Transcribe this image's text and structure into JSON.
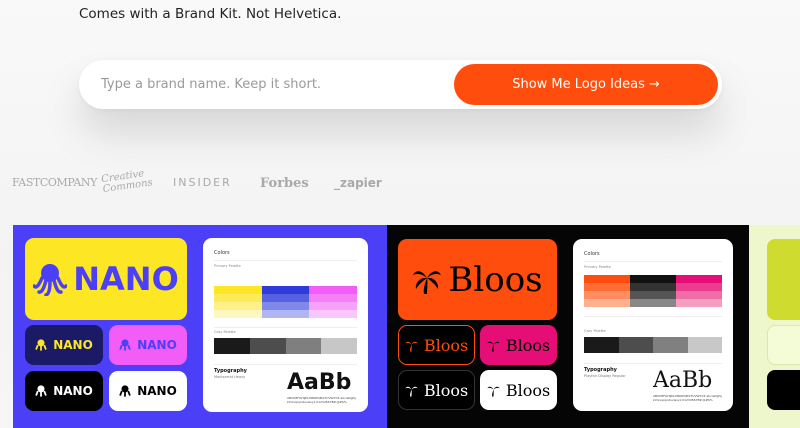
{
  "tagline": "Comes with a Brand Kit. Not Helvetica.",
  "search": {
    "placeholder": "Type a brand name. Keep it short.",
    "button_label": "Show Me Logo Ideas",
    "button_arrow": "→"
  },
  "press_logos": [
    "FASTCOMPANY",
    "Creative Commons",
    "INSIDER",
    "Forbes",
    "_zapier"
  ],
  "brand_nano": {
    "name": "NANO",
    "colors": {
      "panel": "#4b3ff7",
      "yellow": "#fde725",
      "navy": "#1b1a66",
      "pink": "#f15df6",
      "black": "#000000",
      "white": "#ffffff"
    },
    "card": {
      "colors_heading": "Colors",
      "primary_label": "Primary Palette",
      "gray_label": "Gray Palette",
      "typography_label": "Typography",
      "typography_sub": "Montserrat Heavy",
      "specimen": "AaBb",
      "glyphs": "ABCDEFGHIJKLMNOPQRSTUVWXYZ abcdefghijklmnopqrstuvwxyz 0123456789!@#$%"
    }
  },
  "brand_bloos": {
    "name": "Bloos",
    "colors": {
      "orange": "#ff4d0d",
      "magenta": "#e60d77",
      "black": "#000000",
      "white": "#ffffff"
    },
    "card": {
      "colors_heading": "Colors",
      "primary_label": "Primary Palette",
      "gray_label": "Gray Palette",
      "typography_label": "Typography",
      "typography_sub": "Playfair Display Regular",
      "specimen": "AaBb",
      "glyphs": "ABCDEFGHIJKLMNOPQRSTUVWXYZ abcdefghijklmnopqrstuvwxyz 0123456789!@#$%"
    }
  },
  "icons": [
    "arrow-right-icon",
    "octopus-icon",
    "palm-leaf-icon"
  ]
}
